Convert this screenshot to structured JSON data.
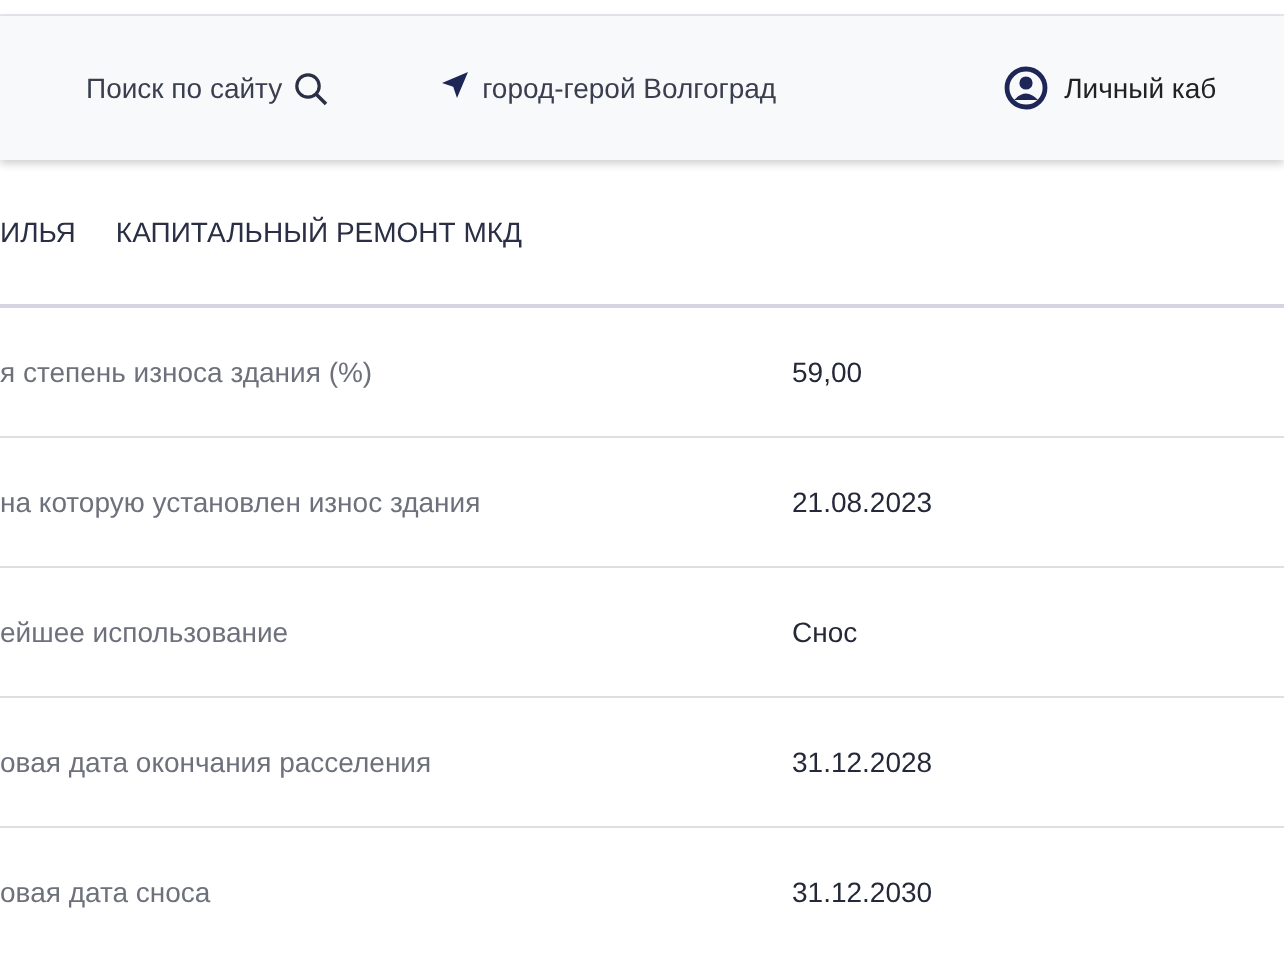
{
  "header": {
    "search": "Поиск по сайту",
    "city": "город-герой Волгоград",
    "account": "Личный каб"
  },
  "nav": [
    {
      "label": "ИЛЬЯ"
    },
    {
      "label": "КАПИТАЛЬНЫЙ РЕМОНТ МКД"
    }
  ],
  "rows": [
    {
      "label": "я степень износа здания (%)",
      "value": "59,00"
    },
    {
      "label": "на которую установлен износ здания",
      "value": "21.08.2023"
    },
    {
      "label": "ейшее использование",
      "value": "Снос"
    },
    {
      "label": "овая дата окончания расселения",
      "value": "31.12.2028"
    },
    {
      "label": "овая дата сноса",
      "value": "31.12.2030"
    }
  ]
}
